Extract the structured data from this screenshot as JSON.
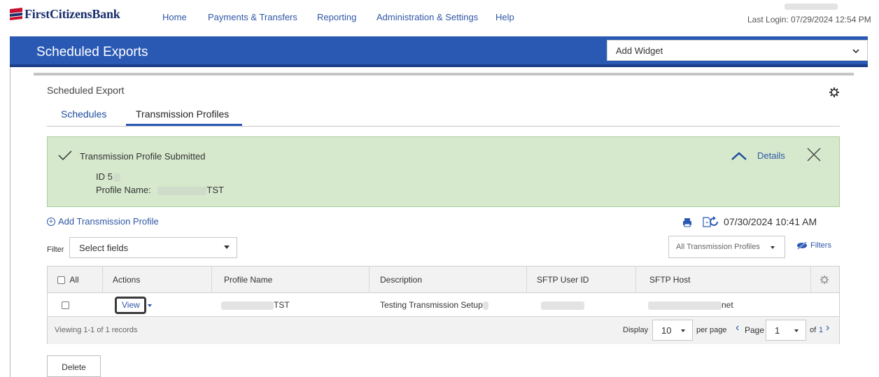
{
  "brand": {
    "name": "FirstCitizensBank",
    "accent": "#2a59b4",
    "banner_bg": "#d6e9cd"
  },
  "nav": {
    "items": [
      "Home",
      "Payments & Transfers",
      "Reporting",
      "Administration & Settings",
      "Help"
    ],
    "last_login": "Last Login: 07/29/2024 12:54 PM"
  },
  "page": {
    "title": "Scheduled Exports",
    "add_widget": "Add Widget"
  },
  "section": {
    "title": "Scheduled Export",
    "tabs": [
      {
        "label": "Schedules",
        "active": false
      },
      {
        "label": "Transmission Profiles",
        "active": true
      }
    ]
  },
  "banner": {
    "message": "Transmission Profile Submitted",
    "id_label": "ID 5",
    "profile_label": "Profile Name:",
    "profile_suffix": "TST",
    "details_label": "Details"
  },
  "toolbar": {
    "add_profile": "Add Transmission Profile",
    "timestamp": "07/30/2024 10:41 AM",
    "filter_label": "Filter",
    "filter_placeholder": "Select fields",
    "profile_filter": "All Transmission Profiles",
    "filters_link": "Filters"
  },
  "table": {
    "all_label": "All",
    "columns": [
      "Actions",
      "Profile Name",
      "Description",
      "SFTP User ID",
      "SFTP Host"
    ],
    "rows": [
      {
        "action": "View",
        "profile_suffix": "TST",
        "description": "Testing Transmission Setup",
        "host_suffix": "net"
      }
    ],
    "footer": {
      "records": "Viewing 1-1 of 1 records",
      "display_label": "Display",
      "per_page_value": "10",
      "per_page_label": "per page",
      "page_label": "Page",
      "page_value": "1",
      "of_label": "of",
      "total_pages": "1"
    }
  },
  "actions": {
    "delete": "Delete"
  }
}
